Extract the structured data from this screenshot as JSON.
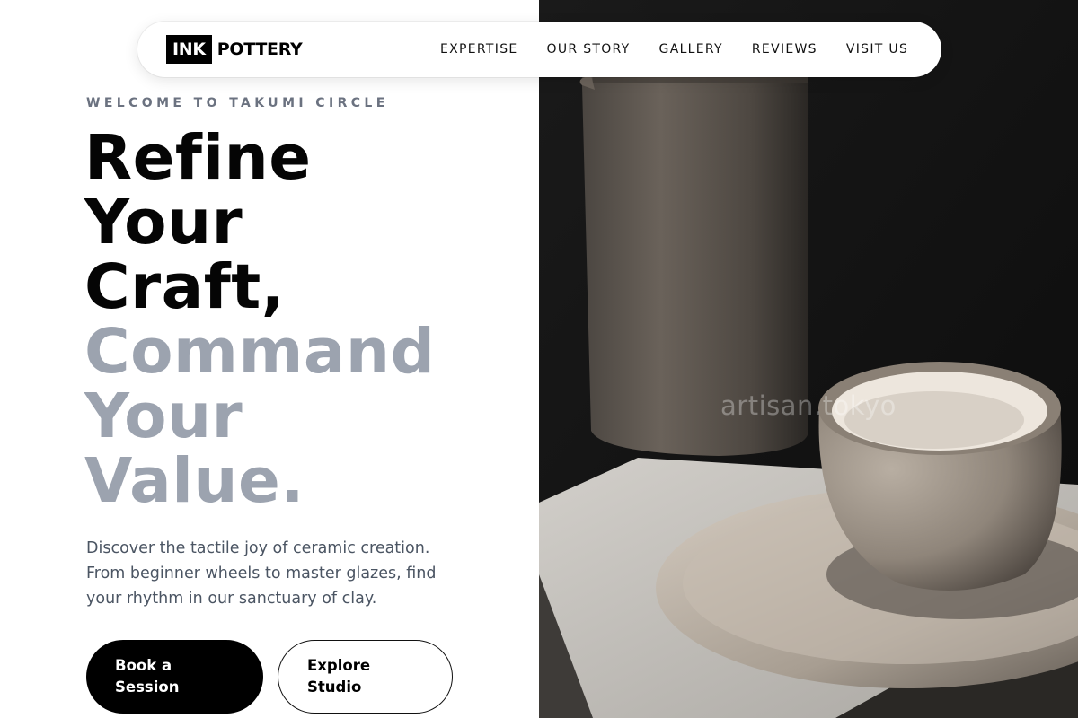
{
  "nav": {
    "logo_box": "INK",
    "logo_text": "POTTERY",
    "links": [
      "EXPERTISE",
      "OUR STORY",
      "GALLERY",
      "REVIEWS",
      "VISIT US"
    ]
  },
  "hero": {
    "eyebrow": "WELCOME TO TAKUMI CIRCLE",
    "headline_dark": [
      "Refine",
      "Your",
      "Craft,"
    ],
    "headline_muted": [
      "Command",
      "Your",
      "Value."
    ],
    "description": "Discover the tactile joy of ceramic creation. From beginner wheels to master glazes, find your rhythm in our sanctuary of clay.",
    "primary_button": "Book a Session",
    "secondary_button": "Explore Studio"
  },
  "photo": {
    "watermark": "artisan.tokyo"
  },
  "colors": {
    "accent": "#000000",
    "muted_headline": "#9ca3af",
    "eyebrow": "#6b7280",
    "body_text": "#4b5563"
  }
}
